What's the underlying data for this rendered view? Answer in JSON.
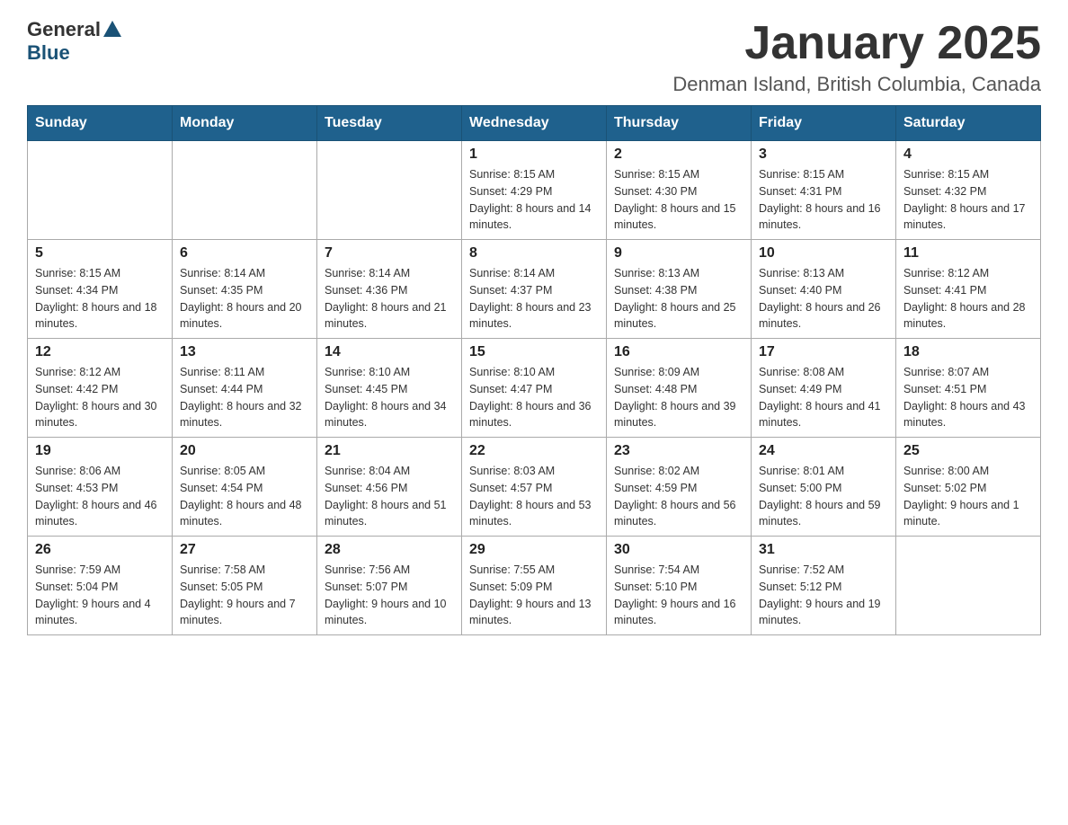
{
  "header": {
    "logo": {
      "text_general": "General",
      "text_blue": "Blue"
    },
    "month": "January 2025",
    "location": "Denman Island, British Columbia, Canada"
  },
  "days_of_week": [
    "Sunday",
    "Monday",
    "Tuesday",
    "Wednesday",
    "Thursday",
    "Friday",
    "Saturday"
  ],
  "weeks": [
    [
      null,
      null,
      null,
      {
        "day": "1",
        "sunrise": "Sunrise: 8:15 AM",
        "sunset": "Sunset: 4:29 PM",
        "daylight": "Daylight: 8 hours and 14 minutes."
      },
      {
        "day": "2",
        "sunrise": "Sunrise: 8:15 AM",
        "sunset": "Sunset: 4:30 PM",
        "daylight": "Daylight: 8 hours and 15 minutes."
      },
      {
        "day": "3",
        "sunrise": "Sunrise: 8:15 AM",
        "sunset": "Sunset: 4:31 PM",
        "daylight": "Daylight: 8 hours and 16 minutes."
      },
      {
        "day": "4",
        "sunrise": "Sunrise: 8:15 AM",
        "sunset": "Sunset: 4:32 PM",
        "daylight": "Daylight: 8 hours and 17 minutes."
      }
    ],
    [
      {
        "day": "5",
        "sunrise": "Sunrise: 8:15 AM",
        "sunset": "Sunset: 4:34 PM",
        "daylight": "Daylight: 8 hours and 18 minutes."
      },
      {
        "day": "6",
        "sunrise": "Sunrise: 8:14 AM",
        "sunset": "Sunset: 4:35 PM",
        "daylight": "Daylight: 8 hours and 20 minutes."
      },
      {
        "day": "7",
        "sunrise": "Sunrise: 8:14 AM",
        "sunset": "Sunset: 4:36 PM",
        "daylight": "Daylight: 8 hours and 21 minutes."
      },
      {
        "day": "8",
        "sunrise": "Sunrise: 8:14 AM",
        "sunset": "Sunset: 4:37 PM",
        "daylight": "Daylight: 8 hours and 23 minutes."
      },
      {
        "day": "9",
        "sunrise": "Sunrise: 8:13 AM",
        "sunset": "Sunset: 4:38 PM",
        "daylight": "Daylight: 8 hours and 25 minutes."
      },
      {
        "day": "10",
        "sunrise": "Sunrise: 8:13 AM",
        "sunset": "Sunset: 4:40 PM",
        "daylight": "Daylight: 8 hours and 26 minutes."
      },
      {
        "day": "11",
        "sunrise": "Sunrise: 8:12 AM",
        "sunset": "Sunset: 4:41 PM",
        "daylight": "Daylight: 8 hours and 28 minutes."
      }
    ],
    [
      {
        "day": "12",
        "sunrise": "Sunrise: 8:12 AM",
        "sunset": "Sunset: 4:42 PM",
        "daylight": "Daylight: 8 hours and 30 minutes."
      },
      {
        "day": "13",
        "sunrise": "Sunrise: 8:11 AM",
        "sunset": "Sunset: 4:44 PM",
        "daylight": "Daylight: 8 hours and 32 minutes."
      },
      {
        "day": "14",
        "sunrise": "Sunrise: 8:10 AM",
        "sunset": "Sunset: 4:45 PM",
        "daylight": "Daylight: 8 hours and 34 minutes."
      },
      {
        "day": "15",
        "sunrise": "Sunrise: 8:10 AM",
        "sunset": "Sunset: 4:47 PM",
        "daylight": "Daylight: 8 hours and 36 minutes."
      },
      {
        "day": "16",
        "sunrise": "Sunrise: 8:09 AM",
        "sunset": "Sunset: 4:48 PM",
        "daylight": "Daylight: 8 hours and 39 minutes."
      },
      {
        "day": "17",
        "sunrise": "Sunrise: 8:08 AM",
        "sunset": "Sunset: 4:49 PM",
        "daylight": "Daylight: 8 hours and 41 minutes."
      },
      {
        "day": "18",
        "sunrise": "Sunrise: 8:07 AM",
        "sunset": "Sunset: 4:51 PM",
        "daylight": "Daylight: 8 hours and 43 minutes."
      }
    ],
    [
      {
        "day": "19",
        "sunrise": "Sunrise: 8:06 AM",
        "sunset": "Sunset: 4:53 PM",
        "daylight": "Daylight: 8 hours and 46 minutes."
      },
      {
        "day": "20",
        "sunrise": "Sunrise: 8:05 AM",
        "sunset": "Sunset: 4:54 PM",
        "daylight": "Daylight: 8 hours and 48 minutes."
      },
      {
        "day": "21",
        "sunrise": "Sunrise: 8:04 AM",
        "sunset": "Sunset: 4:56 PM",
        "daylight": "Daylight: 8 hours and 51 minutes."
      },
      {
        "day": "22",
        "sunrise": "Sunrise: 8:03 AM",
        "sunset": "Sunset: 4:57 PM",
        "daylight": "Daylight: 8 hours and 53 minutes."
      },
      {
        "day": "23",
        "sunrise": "Sunrise: 8:02 AM",
        "sunset": "Sunset: 4:59 PM",
        "daylight": "Daylight: 8 hours and 56 minutes."
      },
      {
        "day": "24",
        "sunrise": "Sunrise: 8:01 AM",
        "sunset": "Sunset: 5:00 PM",
        "daylight": "Daylight: 8 hours and 59 minutes."
      },
      {
        "day": "25",
        "sunrise": "Sunrise: 8:00 AM",
        "sunset": "Sunset: 5:02 PM",
        "daylight": "Daylight: 9 hours and 1 minute."
      }
    ],
    [
      {
        "day": "26",
        "sunrise": "Sunrise: 7:59 AM",
        "sunset": "Sunset: 5:04 PM",
        "daylight": "Daylight: 9 hours and 4 minutes."
      },
      {
        "day": "27",
        "sunrise": "Sunrise: 7:58 AM",
        "sunset": "Sunset: 5:05 PM",
        "daylight": "Daylight: 9 hours and 7 minutes."
      },
      {
        "day": "28",
        "sunrise": "Sunrise: 7:56 AM",
        "sunset": "Sunset: 5:07 PM",
        "daylight": "Daylight: 9 hours and 10 minutes."
      },
      {
        "day": "29",
        "sunrise": "Sunrise: 7:55 AM",
        "sunset": "Sunset: 5:09 PM",
        "daylight": "Daylight: 9 hours and 13 minutes."
      },
      {
        "day": "30",
        "sunrise": "Sunrise: 7:54 AM",
        "sunset": "Sunset: 5:10 PM",
        "daylight": "Daylight: 9 hours and 16 minutes."
      },
      {
        "day": "31",
        "sunrise": "Sunrise: 7:52 AM",
        "sunset": "Sunset: 5:12 PM",
        "daylight": "Daylight: 9 hours and 19 minutes."
      },
      null
    ]
  ]
}
